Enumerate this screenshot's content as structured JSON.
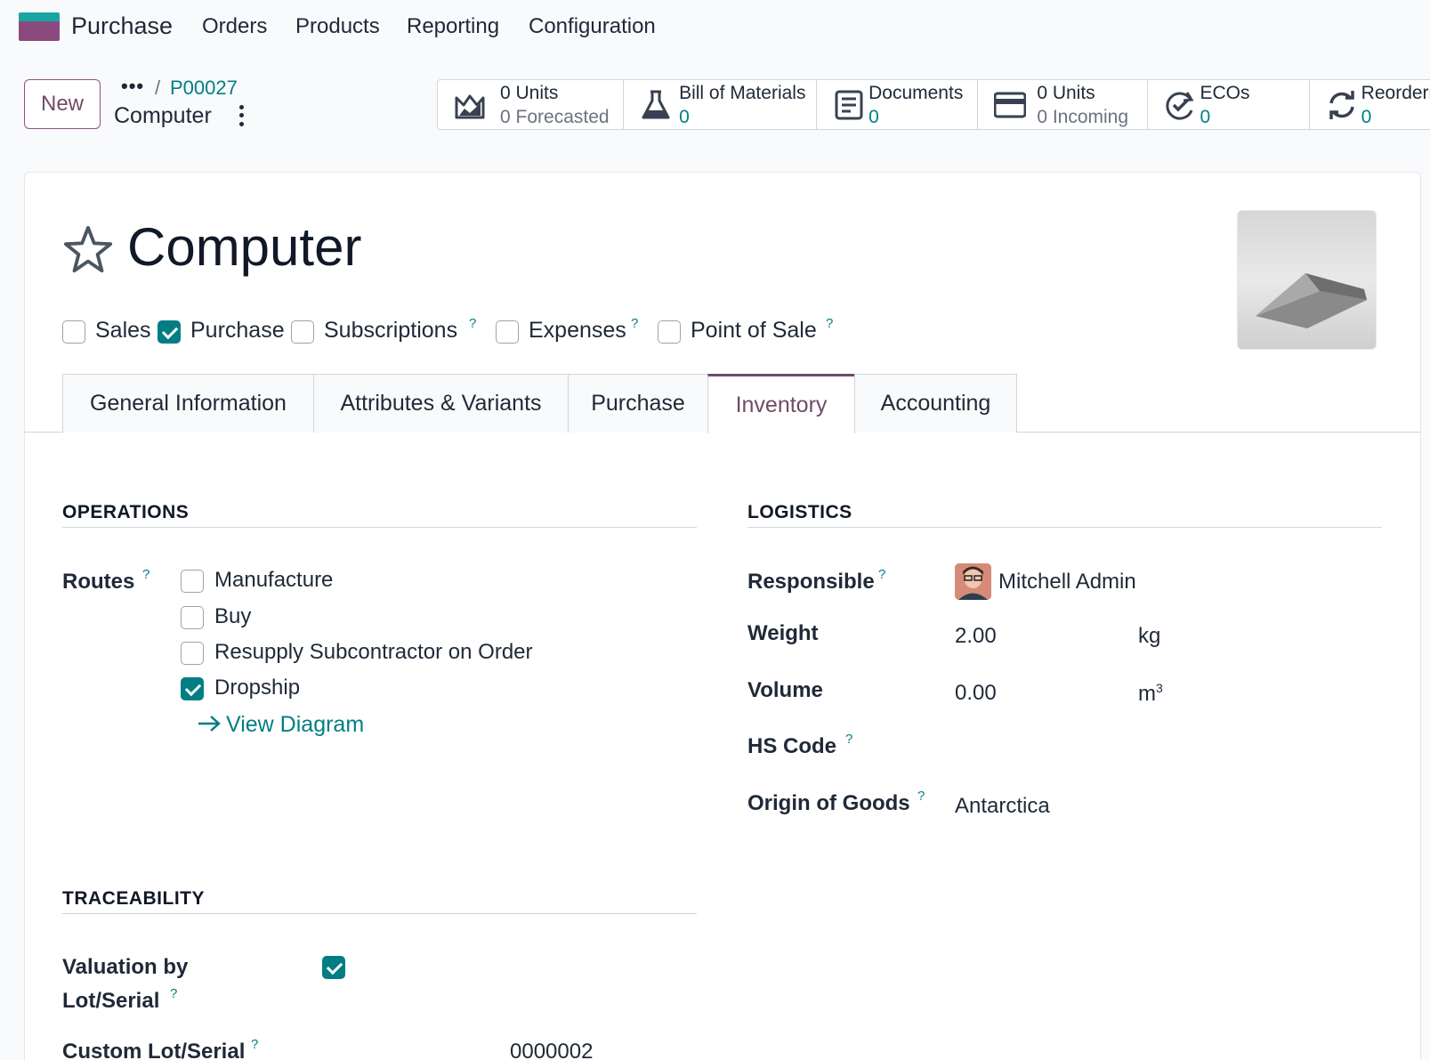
{
  "navbar": {
    "app_name": "Purchase",
    "menu": [
      "Orders",
      "Products",
      "Reporting",
      "Configuration"
    ]
  },
  "control": {
    "new_label": "New",
    "breadcrumb_dots": "•••",
    "breadcrumb_sep": "/",
    "breadcrumb_parent": "P00027",
    "breadcrumb_current": "Computer"
  },
  "smart_buttons": [
    {
      "icon": "forecast-chart-icon",
      "line1": "0 Units",
      "line2": "0 Forecasted"
    },
    {
      "icon": "flask-icon",
      "line1": "Bill of Materials",
      "line2": "0"
    },
    {
      "icon": "document-icon",
      "line1": "Documents",
      "line2": "0"
    },
    {
      "icon": "card-icon",
      "line1": "0 Units",
      "line2": "0 Incoming"
    },
    {
      "icon": "eco-refresh-check-icon",
      "line1": "ECOs",
      "line2": "0"
    },
    {
      "icon": "refresh-icon",
      "line1": "Reorderi",
      "line2": "0"
    }
  ],
  "product": {
    "name": "Computer",
    "flags": [
      {
        "label": "Sales",
        "checked": false,
        "help": false
      },
      {
        "label": "Purchase",
        "checked": true,
        "help": false
      },
      {
        "label": "Subscriptions",
        "checked": false,
        "help": true
      },
      {
        "label": "Expenses",
        "checked": false,
        "help": true
      },
      {
        "label": "Point of Sale",
        "checked": false,
        "help": true
      }
    ]
  },
  "tabs": [
    {
      "label": "General Information",
      "active": false
    },
    {
      "label": "Attributes & Variants",
      "active": false
    },
    {
      "label": "Purchase",
      "active": false
    },
    {
      "label": "Inventory",
      "active": true
    },
    {
      "label": "Accounting",
      "active": false
    }
  ],
  "help_mark": "?",
  "operations": {
    "title": "OPERATIONS",
    "routes_label": "Routes",
    "routes": [
      {
        "label": "Manufacture",
        "checked": false
      },
      {
        "label": "Buy",
        "checked": false
      },
      {
        "label": "Resupply Subcontractor on Order",
        "checked": false
      },
      {
        "label": "Dropship",
        "checked": true
      }
    ],
    "view_diagram": "View Diagram"
  },
  "logistics": {
    "title": "LOGISTICS",
    "responsible_label": "Responsible",
    "responsible_value": "Mitchell Admin",
    "weight_label": "Weight",
    "weight_value": "2.00",
    "weight_unit": "kg",
    "volume_label": "Volume",
    "volume_value": "0.00",
    "volume_unit": "m",
    "volume_unit_sup": "3",
    "hs_label": "HS Code",
    "origin_label": "Origin of Goods",
    "origin_value": "Antarctica"
  },
  "traceability": {
    "title": "TRACEABILITY",
    "valuation_label_1": "Valuation by",
    "valuation_label_2": "Lot/Serial",
    "valuation_checked": true,
    "custom_lot_label": "Custom Lot/Serial",
    "custom_lot_value": "0000002"
  },
  "colors": {
    "brand": "#714b67",
    "accent": "#017e84"
  }
}
